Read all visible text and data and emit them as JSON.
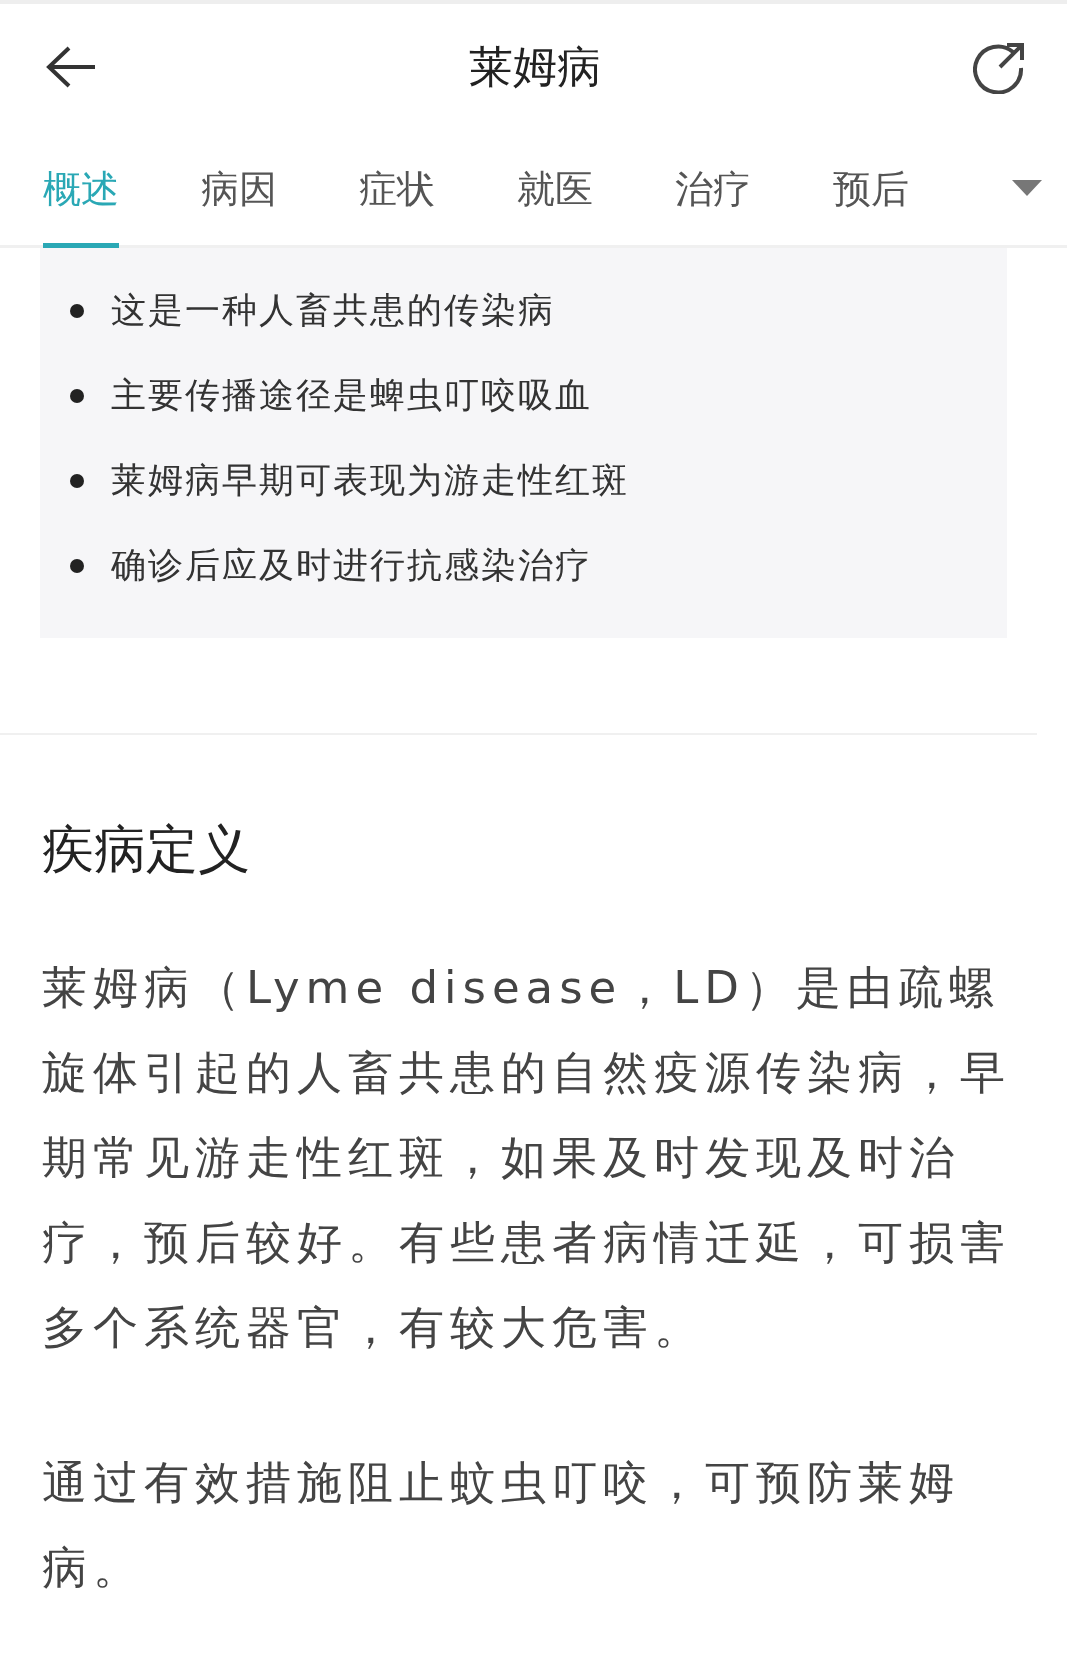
{
  "header": {
    "title": "莱姆病"
  },
  "tabs": [
    {
      "label": "概述",
      "selected": true
    },
    {
      "label": "病因",
      "selected": false
    },
    {
      "label": "症状",
      "selected": false
    },
    {
      "label": "就医",
      "selected": false
    },
    {
      "label": "治疗",
      "selected": false
    },
    {
      "label": "预后",
      "selected": false
    }
  ],
  "summary": {
    "items": [
      "这是一种人畜共患的传染病",
      "主要传播途径是蜱虫叮咬吸血",
      "莱姆病早期可表现为游走性红斑",
      "确诊后应及时进行抗感染治疗"
    ]
  },
  "section": {
    "heading": "疾病定义",
    "paragraphs": [
      "莱姆病（Lyme disease，LD）是由疏螺旋体引起的人畜共患的自然疫源传染病，早期常见游走性红斑，如果及时发现及时治疗，预后较好。有些患者病情迁延，可损害多个系统器官，有较大危害。",
      "通过有效措施阻止蚊虫叮咬，可预防莱姆病。"
    ]
  }
}
